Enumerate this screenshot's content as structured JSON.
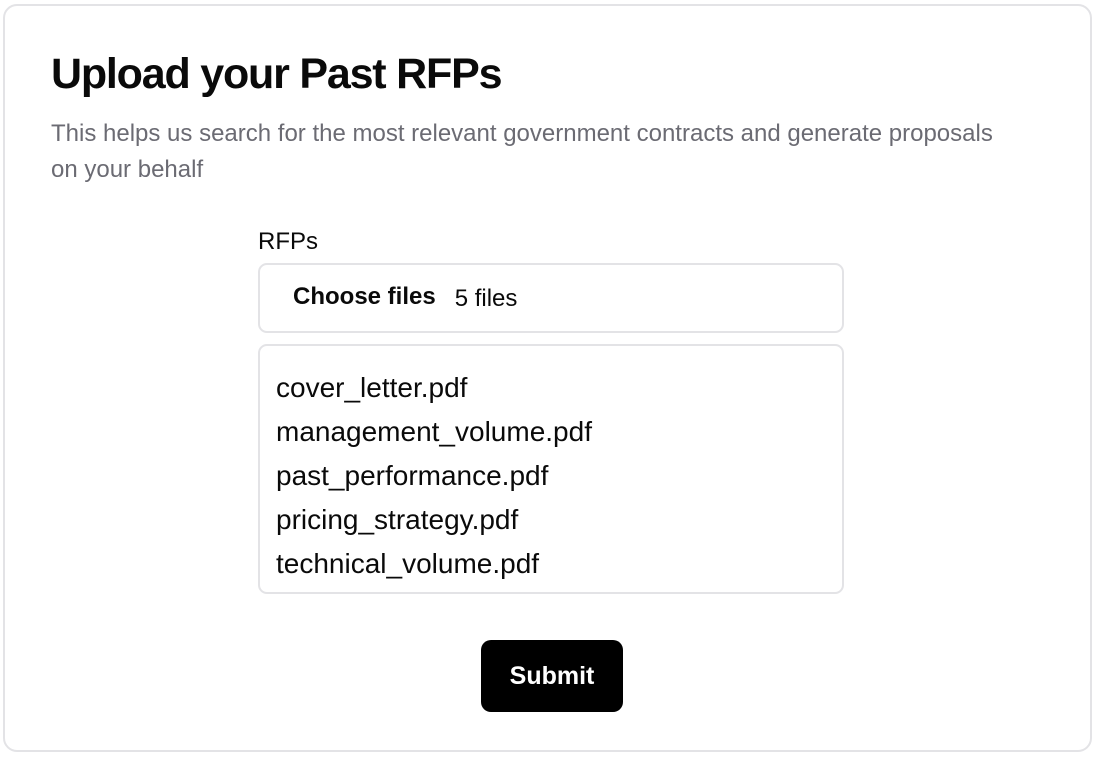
{
  "form": {
    "title": "Upload your Past RFPs",
    "subtitle": "This helps us search for the most relevant government contracts and generate proposals on your behalf",
    "field_label": "RFPs",
    "file_input": {
      "button_label": "Choose files",
      "status": "5 files"
    },
    "files": [
      "cover_letter.pdf",
      "management_volume.pdf",
      "past_performance.pdf",
      "pricing_strategy.pdf",
      "technical_volume.pdf"
    ],
    "submit_label": "Submit"
  },
  "colors": {
    "text_primary": "#0a0a0a",
    "text_muted": "#6b6b73",
    "border": "#e3e3e6",
    "button_bg": "#000000",
    "button_text": "#ffffff"
  }
}
